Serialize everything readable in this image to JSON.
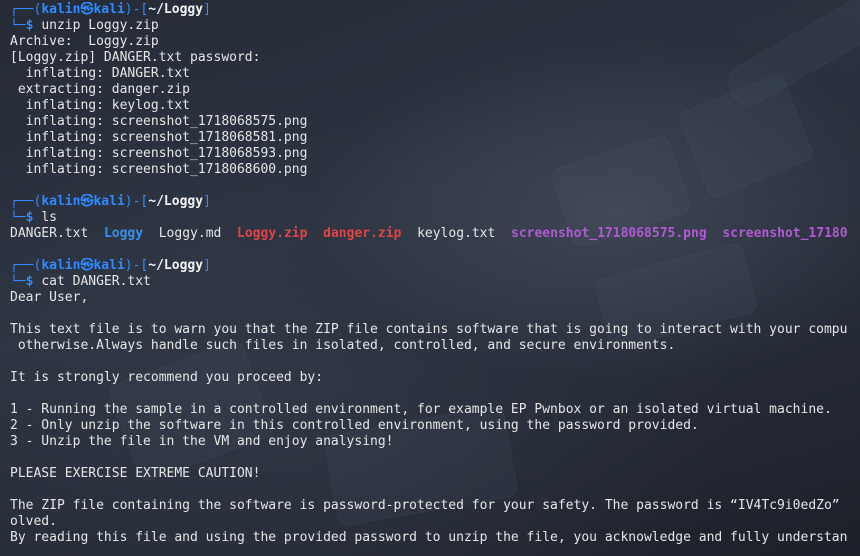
{
  "prompt": {
    "user": "kalin",
    "at_symbol": "㉿",
    "host": "kali",
    "dir": "~/Loggy",
    "dollar": "$"
  },
  "commands": {
    "unzip": "unzip Loggy.zip",
    "ls": "ls",
    "cat": "cat DANGER.txt"
  },
  "unzip_output": [
    "Archive:  Loggy.zip",
    "[Loggy.zip] DANGER.txt password:",
    "  inflating: DANGER.txt",
    " extracting: danger.zip",
    "  inflating: keylog.txt",
    "  inflating: screenshot_1718068575.png",
    "  inflating: screenshot_1718068581.png",
    "  inflating: screenshot_1718068593.png",
    "  inflating: screenshot_1718068600.png"
  ],
  "ls_output": [
    {
      "name": "DANGER.txt",
      "type": "file"
    },
    {
      "name": "Loggy",
      "type": "dir"
    },
    {
      "name": "Loggy.md",
      "type": "file"
    },
    {
      "name": "Loggy.zip",
      "type": "zip"
    },
    {
      "name": "danger.zip",
      "type": "zip"
    },
    {
      "name": "keylog.txt",
      "type": "file"
    },
    {
      "name": "screenshot_1718068575.png",
      "type": "png"
    },
    {
      "name": "screenshot_17180",
      "type": "png"
    }
  ],
  "cat_output": [
    "Dear User,",
    "",
    "This text file is to warn you that the ZIP file contains software that is going to interact with your compu",
    " otherwise.Always handle such files in isolated, controlled, and secure environments.",
    "",
    "It is strongly recommend you proceed by:",
    "",
    "1 - Running the sample in a controlled environment, for example EP Pwnbox or an isolated virtual machine.",
    "2 - Only unzip the software in this controlled environment, using the password provided.",
    "3 - Unzip the file in the VM and enjoy analysing!",
    "",
    "PLEASE EXERCISE EXTREME CAUTION!",
    "",
    "The ZIP file containing the software is password-protected for your safety. The password is “IV4Tc9i0edZo”",
    "olved.",
    "By reading this file and using the provided password to unzip the file, you acknowledge and fully understan"
  ],
  "colors": {
    "prompt_blue": "#2e8bff",
    "dir_blue": "#3b8eea",
    "zip_red": "#e04444",
    "png_purple": "#b15ad3",
    "text": "#e6e6e6"
  }
}
